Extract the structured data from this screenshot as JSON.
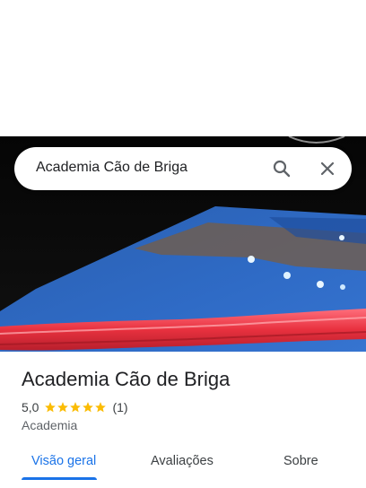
{
  "search": {
    "query": "Academia Cão de Briga",
    "search_icon": "search-icon",
    "close_icon": "close-icon"
  },
  "place": {
    "name": "Academia Cão de Briga",
    "rating": "5,0",
    "rating_value": 5,
    "review_count": "(1)",
    "category": "Academia"
  },
  "tabs": [
    {
      "label": "Visão geral",
      "active": true
    },
    {
      "label": "Avaliações",
      "active": false
    },
    {
      "label": "Sobre",
      "active": false
    }
  ],
  "colors": {
    "accent": "#1a73e8",
    "star": "#fbbc04",
    "text_primary": "#202124",
    "text_secondary": "#5f6368"
  }
}
